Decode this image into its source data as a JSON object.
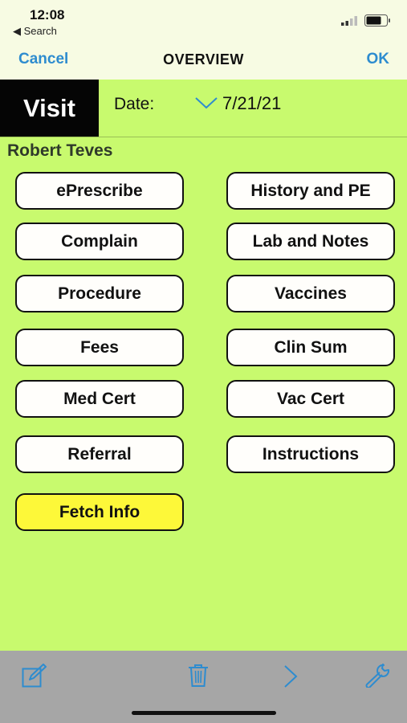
{
  "status": {
    "time": "12:08",
    "back_label": "◀ Search"
  },
  "nav": {
    "cancel": "Cancel",
    "title": "OVERVIEW",
    "ok": "OK"
  },
  "visit": {
    "tab_label": "Visit",
    "date_label": "Date:",
    "date_value": "7/21/21"
  },
  "patient": {
    "name": "Robert Teves"
  },
  "buttons": {
    "eprescribe": "ePrescribe",
    "history_pe": "History and PE",
    "complain": "Complain",
    "lab_notes": "Lab and Notes",
    "procedure": "Procedure",
    "vaccines": "Vaccines",
    "fees": "Fees",
    "clin_sum": "Clin Sum",
    "med_cert": "Med Cert",
    "vac_cert": "Vac Cert",
    "referral": "Referral",
    "instructions": "Instructions",
    "fetch_info": "Fetch Info"
  },
  "toolbar": {
    "icons": [
      "compose-icon",
      "trash-icon",
      "chevron-right-icon",
      "wrench-icon"
    ]
  },
  "colors": {
    "background": "#c8fa6e",
    "header": "#f7fbe3",
    "accent": "#2e8ccf",
    "fetch_button": "#fdf839",
    "toolbar": "#a6a6a6"
  }
}
